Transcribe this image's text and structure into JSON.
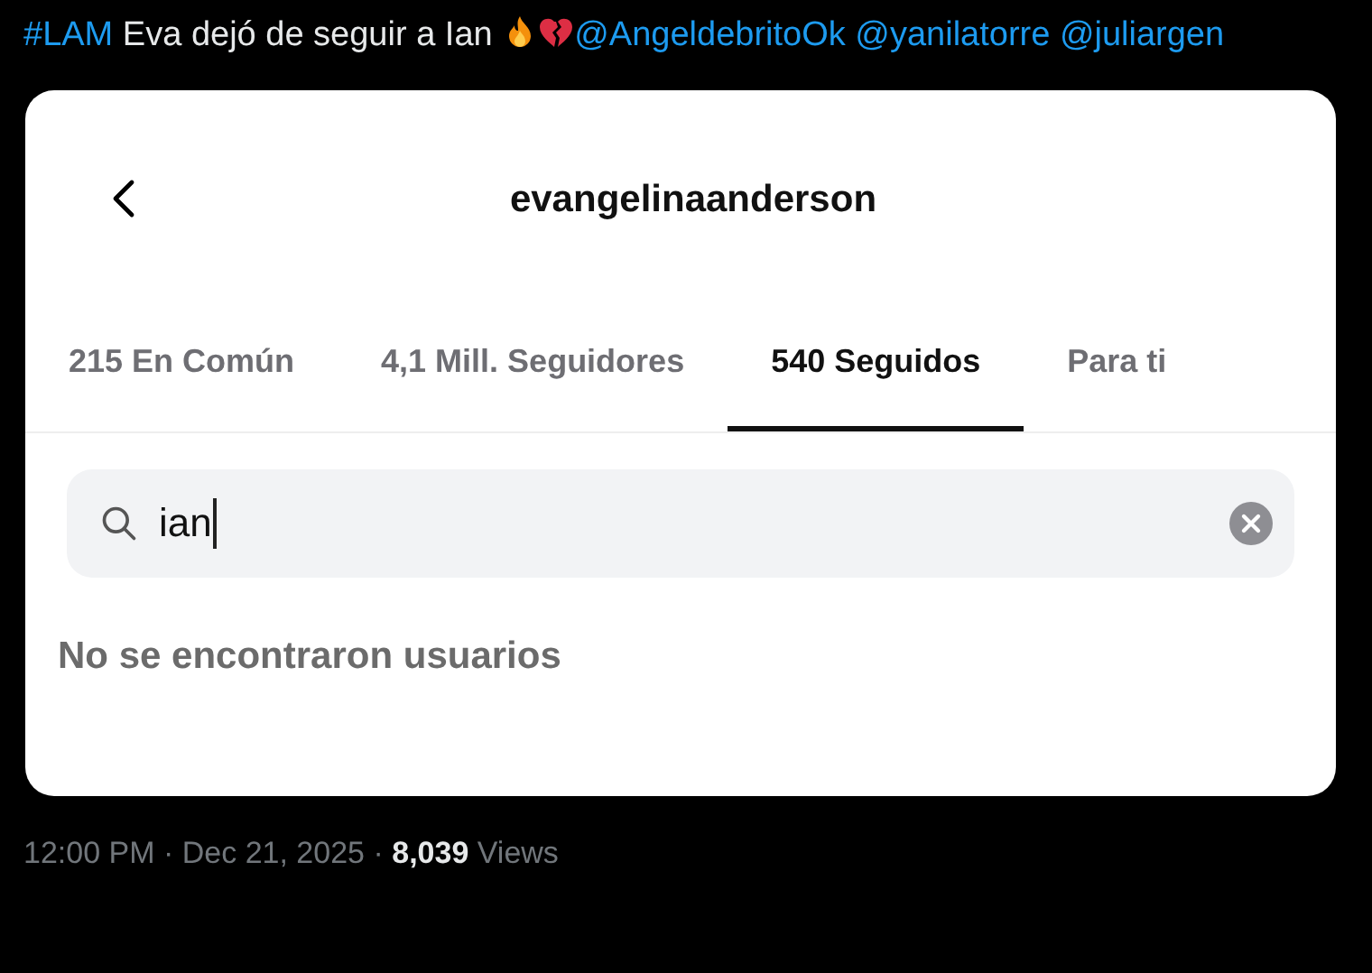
{
  "tweet": {
    "hashtag": "#LAM",
    "text": "Eva dejó de seguir a Ian",
    "mentions": [
      "@AngeldebritoOk",
      "@yanilatorre",
      "@juliargen"
    ]
  },
  "screenshot": {
    "title": "evangelinaanderson",
    "tabs": [
      {
        "label": "215 En Común",
        "selected": false
      },
      {
        "label": "4,1 Mill. Seguidores",
        "selected": false
      },
      {
        "label": "540 Seguidos",
        "selected": true
      },
      {
        "label": "Para ti",
        "selected": false
      }
    ],
    "search": {
      "value": "ian"
    },
    "empty_message": "No se encontraron usuarios"
  },
  "footer": {
    "meta": "12:00 PM · Dec 21, 2025 · **8,039** Views"
  }
}
